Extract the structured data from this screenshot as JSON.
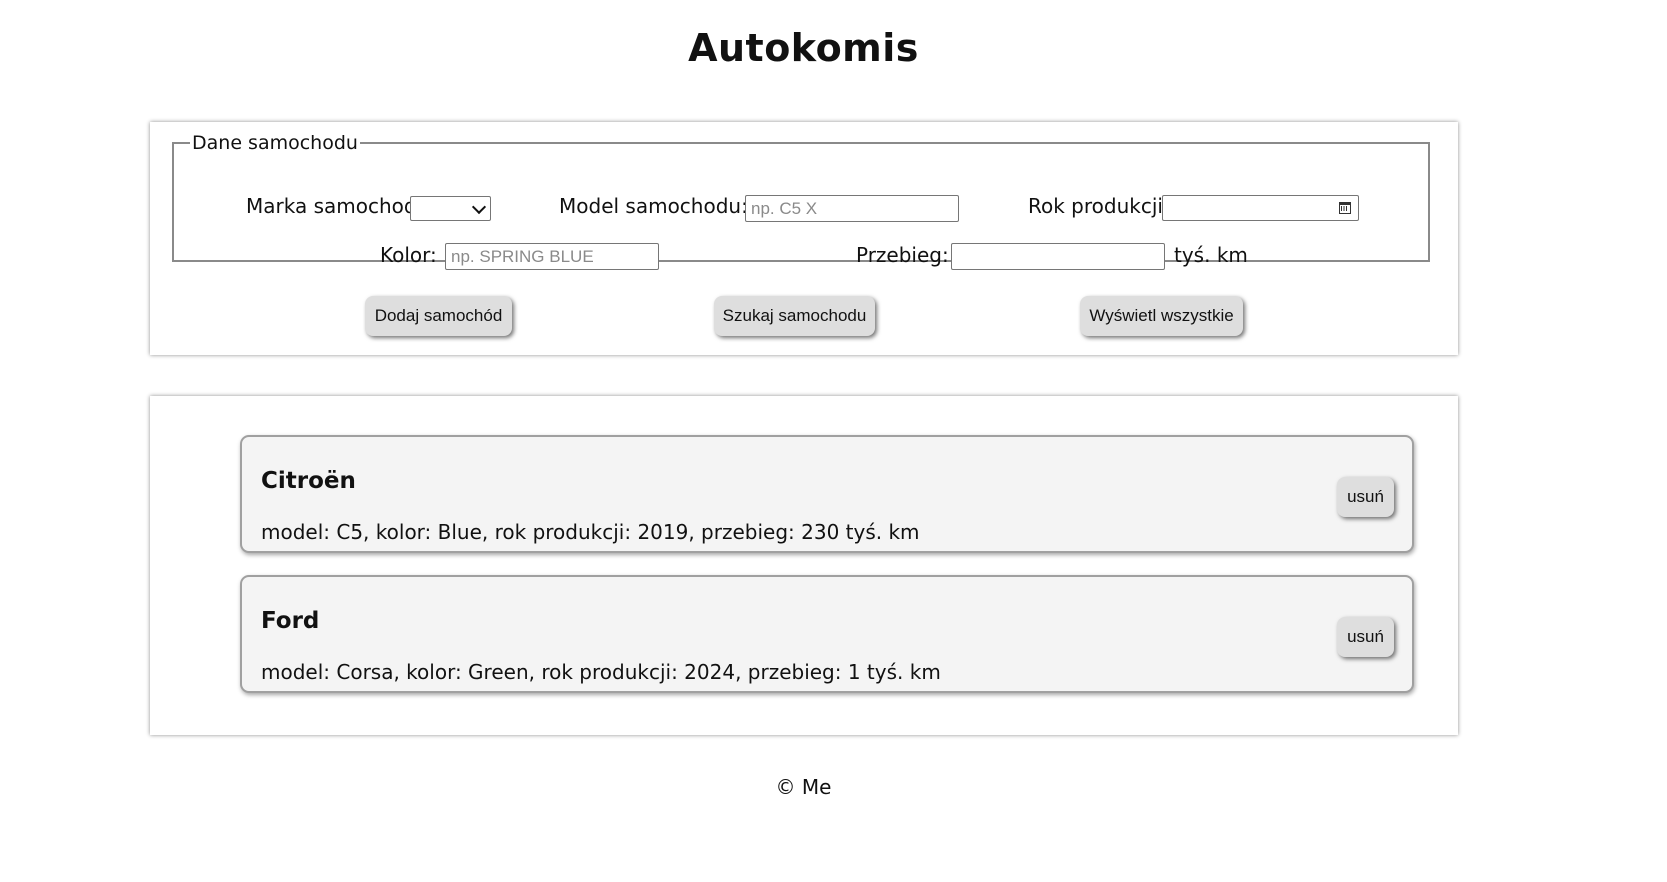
{
  "page": {
    "title": "Autokomis"
  },
  "form": {
    "legend": "Dane samochodu",
    "brand_label": "Marka samochodu:",
    "brand_value": "",
    "model_label": "Model samochodu:",
    "model_placeholder": "np. C5 X",
    "year_label": "Rok produkcji:",
    "year_placeholder": "-----------  ----",
    "color_label": "Kolor:",
    "color_placeholder": "np. SPRING BLUE",
    "mileage_label": "Przebieg:",
    "mileage_value": "",
    "mileage_unit": "tyś. km"
  },
  "buttons": {
    "add": "Dodaj samochód",
    "search": "Szukaj samochodu",
    "show_all": "Wyświetl wszystkie"
  },
  "cars": [
    {
      "brand": "Citroën",
      "details": "model: C5, kolor: Blue, rok produkcji: 2019, przebieg: 230 tyś. km",
      "delete_label": "usuń"
    },
    {
      "brand": "Ford",
      "details": "model: Corsa, kolor: Green, rok produkcji: 2024, przebieg: 1 tyś. km",
      "delete_label": "usuń"
    }
  ],
  "footer": {
    "text": "© Me"
  },
  "icons": {
    "brand_select": "chevron-down-icon",
    "date_picker": "calendar-icon"
  }
}
